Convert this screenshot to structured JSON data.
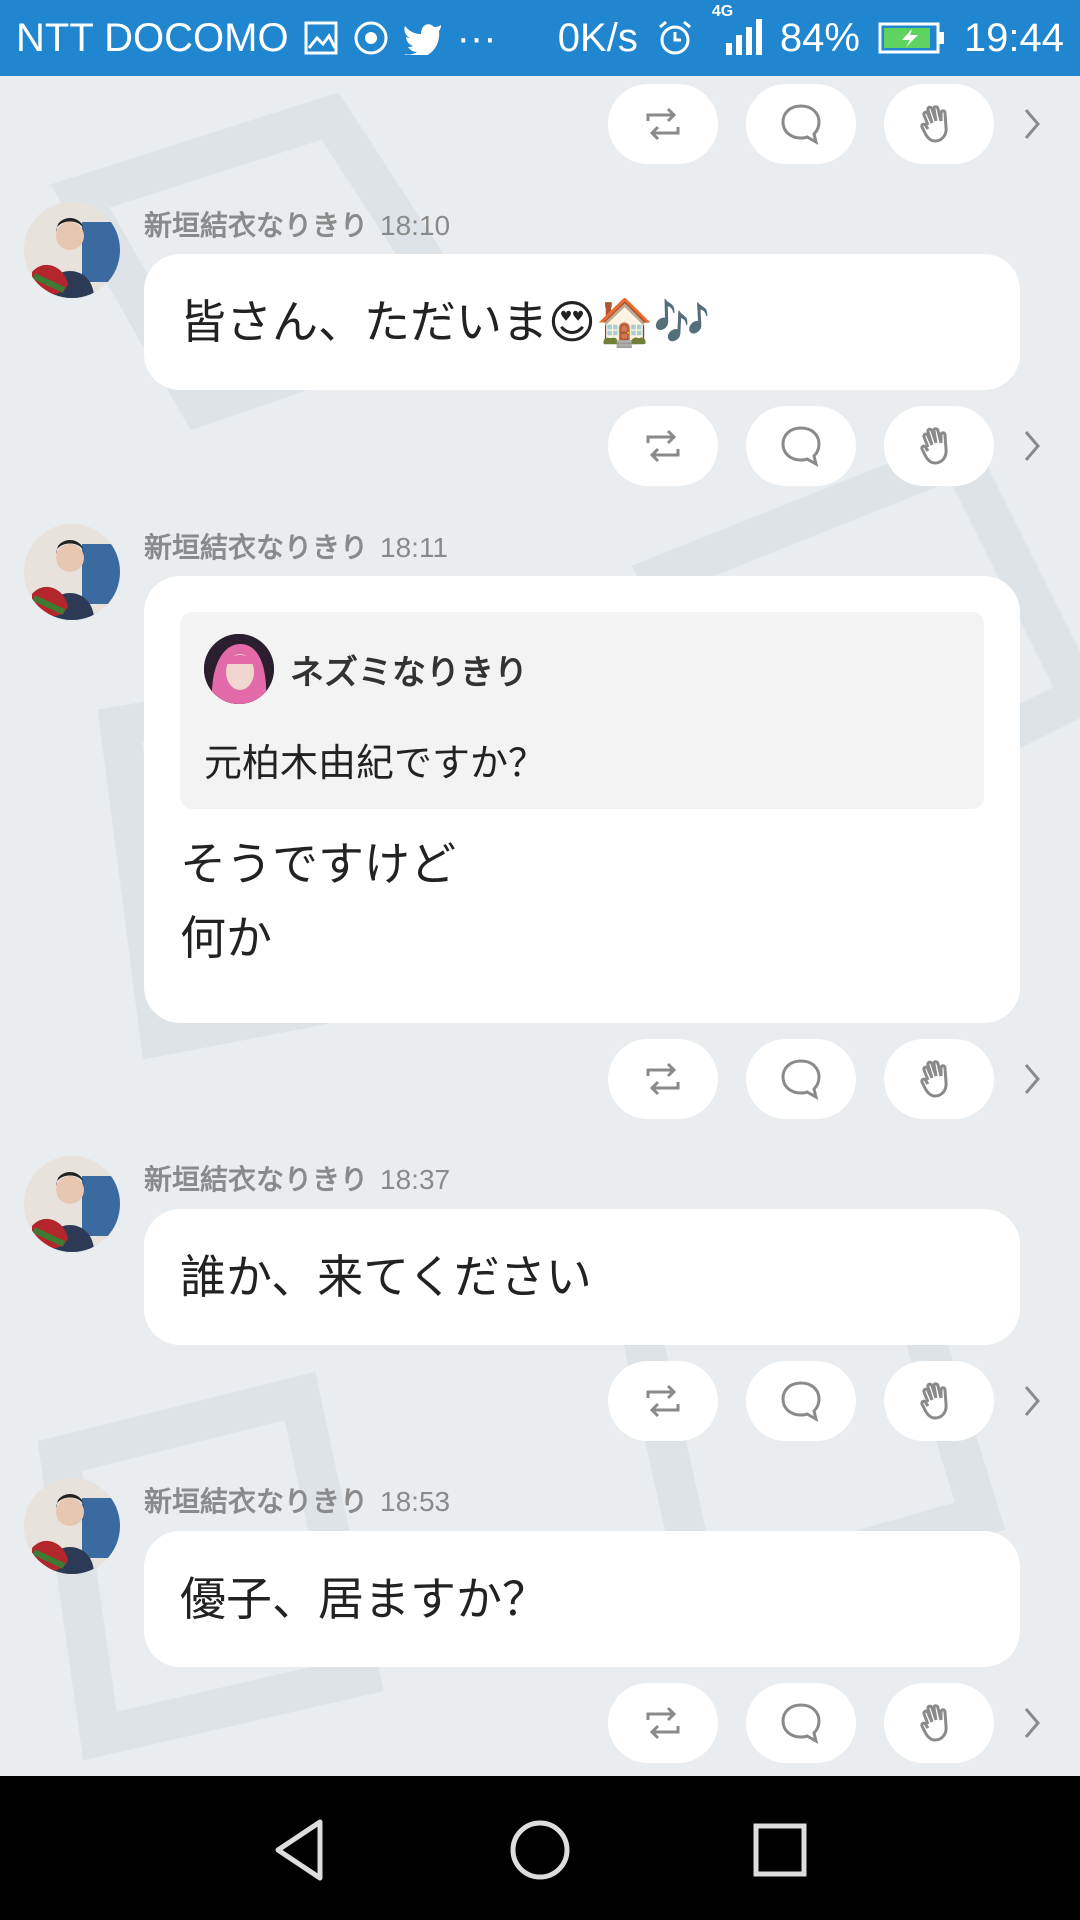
{
  "status_bar": {
    "carrier": "NTT DOCOMO",
    "speed": "0K/s",
    "network": "4G",
    "battery": "84%",
    "time": "19:44",
    "colors": {
      "bar": "#1f86cf"
    }
  },
  "icons": {
    "repost": "repost-icon",
    "comment": "comment-icon",
    "clap": "clap-icon",
    "more": "chevron-right-icon"
  },
  "posts": [
    {
      "author": "新垣結衣なりきり",
      "time": "18:10",
      "text": "皆さん、ただいま😍🏠🎶"
    },
    {
      "author": "新垣結衣なりきり",
      "time": "18:11",
      "quote": {
        "author": "ネズミなりきり",
        "text": "元柏木由紀ですか？"
      },
      "text": "そうですけど\n何か"
    },
    {
      "author": "新垣結衣なりきり",
      "time": "18:37",
      "text": "誰か、来てください"
    },
    {
      "author": "新垣結衣なりきり",
      "time": "18:53",
      "text": "優子、居ますか？"
    }
  ]
}
